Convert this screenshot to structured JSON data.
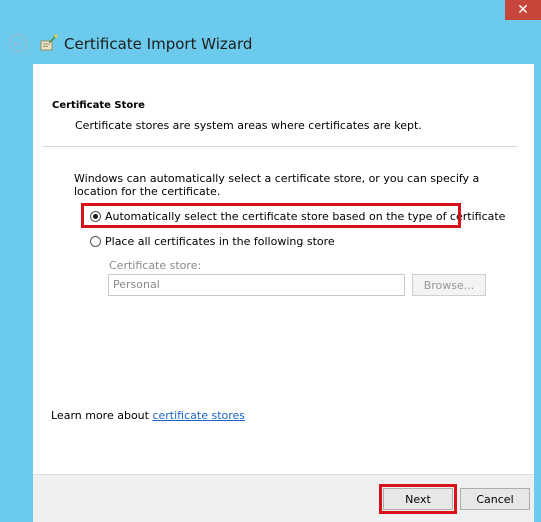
{
  "window": {
    "title": "Certificate Import Wizard",
    "close_label": "✕"
  },
  "section": {
    "title": "Certificate Store",
    "description": "Certificate stores are system areas where certificates are kept."
  },
  "intro": "Windows can automatically select a certificate store, or you can specify a location for the certificate.",
  "options": {
    "auto_label": "Automatically select the certificate store based on the type of certificate",
    "manual_label": "Place all certificates in the following store",
    "selected": "auto"
  },
  "store": {
    "label": "Certificate store:",
    "value": "Personal",
    "browse_label": "Browse..."
  },
  "learn_more": {
    "prefix": "Learn more about ",
    "link_text": "certificate stores"
  },
  "buttons": {
    "next": "Next",
    "cancel": "Cancel"
  },
  "colors": {
    "window_bg": "#6ccbec",
    "highlight": "#d9111a",
    "link": "#1b63c6"
  },
  "icons": [
    "back-arrow-icon",
    "certificate-wizard-icon",
    "close-icon"
  ]
}
